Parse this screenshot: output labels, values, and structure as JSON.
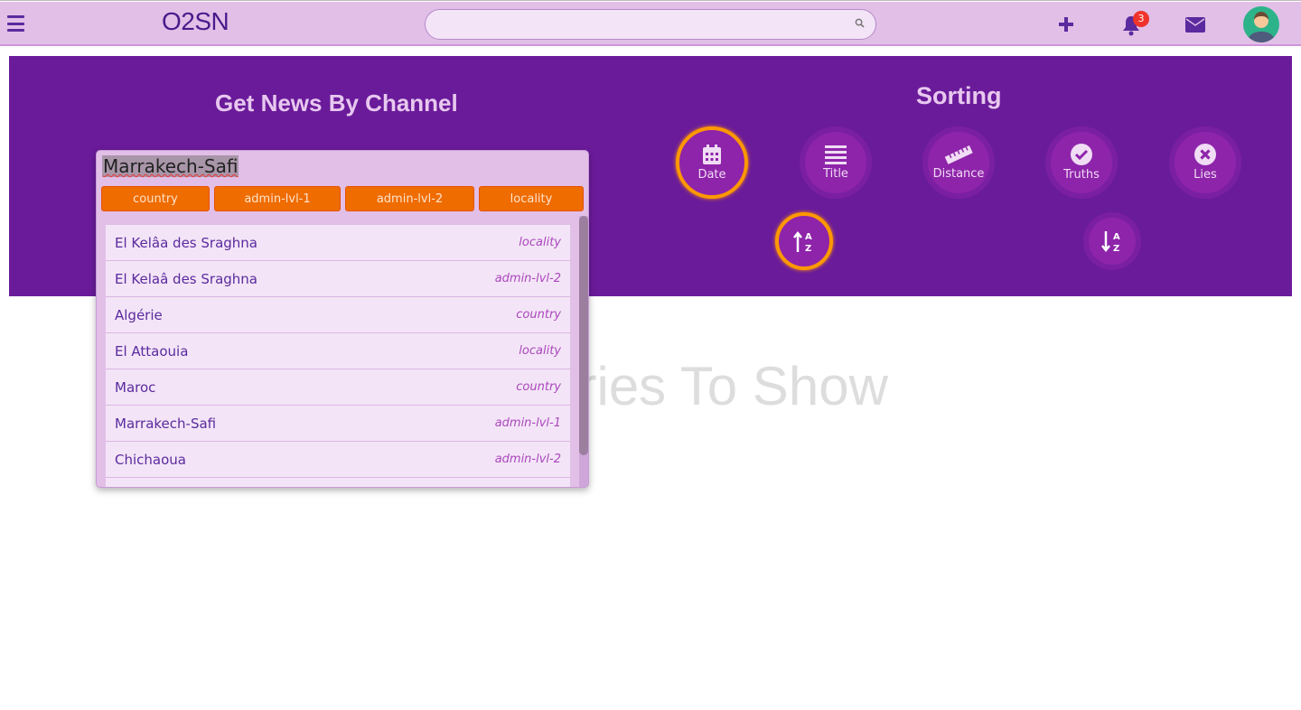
{
  "nav": {
    "logo": "O2SN",
    "search_placeholder": "",
    "notifications_count": "3",
    "icons": [
      "menu-icon",
      "search-icon",
      "plus-icon",
      "bell-icon",
      "envelope-icon",
      "avatar"
    ]
  },
  "left": {
    "title": "Get News By Channel"
  },
  "sorting": {
    "title": "Sorting",
    "options": [
      {
        "label": "Date",
        "icon": "calendar-icon",
        "active": true
      },
      {
        "label": "Title",
        "icon": "list-icon",
        "active": false
      },
      {
        "label": "Distance",
        "icon": "ruler-icon",
        "active": false
      },
      {
        "label": "Truths",
        "icon": "check-circle-icon",
        "active": false
      },
      {
        "label": "Lies",
        "icon": "x-circle-icon",
        "active": false
      }
    ],
    "order": [
      {
        "icon": "sort-alpha-up-icon",
        "active": true
      },
      {
        "icon": "sort-alpha-down-icon",
        "active": false
      }
    ]
  },
  "empty_message": "No Stories To Show",
  "dropdown": {
    "input_value": "Marrakech-Safi",
    "filters": [
      "country",
      "admin-lvl-1",
      "admin-lvl-2",
      "locality"
    ],
    "items": [
      {
        "name": "El Kelâa des Sraghna",
        "type": "locality"
      },
      {
        "name": "El Kelaâ des Sraghna",
        "type": "admin-lvl-2"
      },
      {
        "name": "Algérie",
        "type": "country"
      },
      {
        "name": "El Attaouia",
        "type": "locality"
      },
      {
        "name": "Maroc",
        "type": "country"
      },
      {
        "name": "Marrakech-Safi",
        "type": "admin-lvl-1"
      },
      {
        "name": "Chichaoua",
        "type": "admin-lvl-2"
      },
      {
        "name": "",
        "type": ""
      }
    ]
  },
  "colors": {
    "nav": "#e1bfe7",
    "panel": "#6a1b9a",
    "accent": "#ff9800",
    "filter": "#ef6c00"
  }
}
